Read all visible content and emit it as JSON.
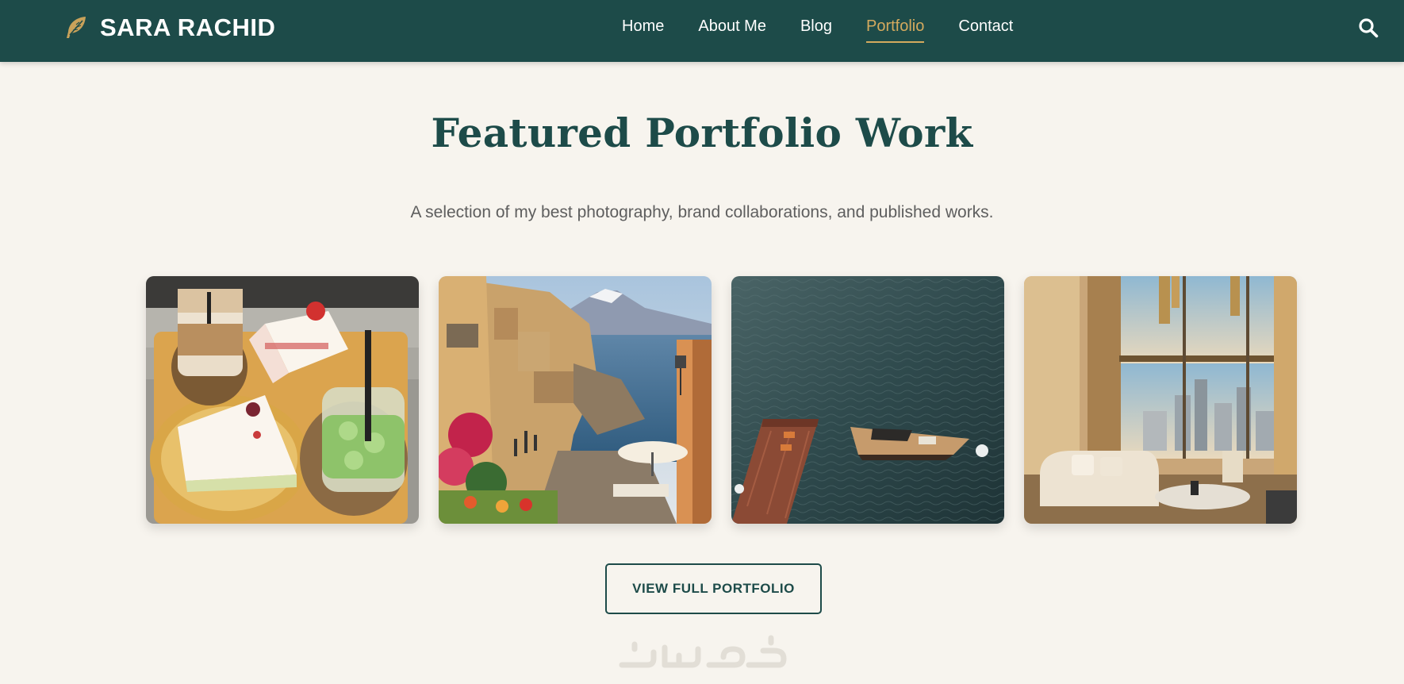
{
  "header": {
    "brand_name": "SARA RACHID",
    "brand_icon": "feather-icon",
    "nav": [
      {
        "label": "Home",
        "active": false
      },
      {
        "label": "About Me",
        "active": false
      },
      {
        "label": "Blog",
        "active": false
      },
      {
        "label": "Portfolio",
        "active": true
      },
      {
        "label": "Contact",
        "active": false
      }
    ],
    "search_icon": "search-icon"
  },
  "section": {
    "title": "Featured Portfolio Work",
    "subtitle": "A selection of my best photography, brand collaborations, and published works."
  },
  "gallery": {
    "items": [
      {
        "subject": "cakes and iced drinks on a wooden tray"
      },
      {
        "subject": "coastal town street with a volcano over the sea"
      },
      {
        "subject": "motorboat beside a wooden dock on dark water"
      },
      {
        "subject": "luxury living room with a city skyline view"
      }
    ]
  },
  "cta": {
    "label": "VIEW FULL PORTFOLIO"
  },
  "watermark": {
    "text": "خمسات"
  },
  "colors": {
    "header_bg": "#1d4b49",
    "page_bg": "#f7f4ee",
    "accent_gold": "#d4aa5e",
    "title_teal": "#1d4b49",
    "subtitle_gray": "#5e5e5e"
  }
}
